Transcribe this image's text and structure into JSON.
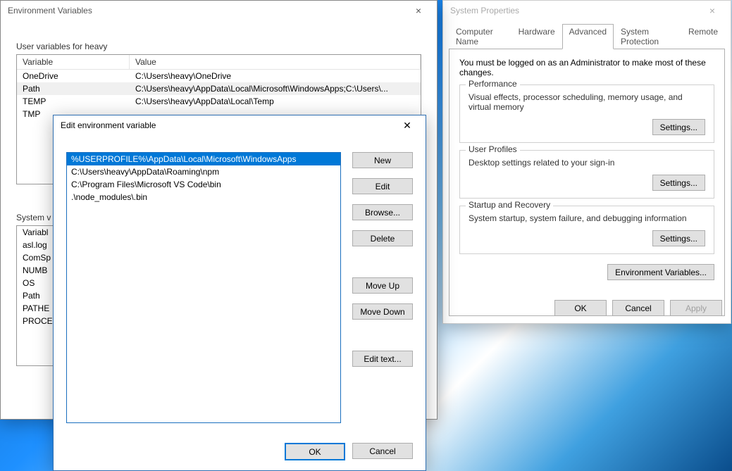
{
  "sysprop": {
    "title": "System Properties",
    "tabs": [
      "Computer Name",
      "Hardware",
      "Advanced",
      "System Protection",
      "Remote"
    ],
    "active_tab": 2,
    "intro": "You must be logged on as an Administrator to make most of these changes.",
    "groups": {
      "performance": {
        "legend": "Performance",
        "text": "Visual effects, processor scheduling, memory usage, and virtual memory",
        "button": "Settings..."
      },
      "userprofiles": {
        "legend": "User Profiles",
        "text": "Desktop settings related to your sign-in",
        "button": "Settings..."
      },
      "startup": {
        "legend": "Startup and Recovery",
        "text": "System startup, system failure, and debugging information",
        "button": "Settings..."
      }
    },
    "envbtn": "Environment Variables...",
    "footer": {
      "ok": "OK",
      "cancel": "Cancel",
      "apply": "Apply"
    }
  },
  "envvar": {
    "title": "Environment Variables",
    "user_section": "User variables for heavy",
    "headers": {
      "variable": "Variable",
      "value": "Value"
    },
    "user_rows": [
      {
        "var": "OneDrive",
        "val": "C:\\Users\\heavy\\OneDrive"
      },
      {
        "var": "Path",
        "val": "C:\\Users\\heavy\\AppData\\Local\\Microsoft\\WindowsApps;C:\\Users\\..."
      },
      {
        "var": "TEMP",
        "val": "C:\\Users\\heavy\\AppData\\Local\\Temp"
      },
      {
        "var": "TMP",
        "val": ""
      }
    ],
    "user_selected": 1,
    "system_section": "System v",
    "system_rows": [
      {
        "var": "Variabl",
        "val": ""
      },
      {
        "var": "asl.log",
        "val": ""
      },
      {
        "var": "ComSp",
        "val": ""
      },
      {
        "var": "NUMB",
        "val": ""
      },
      {
        "var": "OS",
        "val": ""
      },
      {
        "var": "Path",
        "val": ""
      },
      {
        "var": "PATHE",
        "val": ""
      },
      {
        "var": "PROCE",
        "val": ""
      }
    ]
  },
  "editenv": {
    "title": "Edit environment variable",
    "items": [
      "%USERPROFILE%\\AppData\\Local\\Microsoft\\WindowsApps",
      "C:\\Users\\heavy\\AppData\\Roaming\\npm",
      "C:\\Program Files\\Microsoft VS Code\\bin",
      ".\\node_modules\\.bin"
    ],
    "selected": 0,
    "buttons": {
      "new": "New",
      "edit": "Edit",
      "browse": "Browse...",
      "delete": "Delete",
      "moveup": "Move Up",
      "movedown": "Move Down",
      "edittext": "Edit text...",
      "ok": "OK",
      "cancel": "Cancel"
    }
  }
}
